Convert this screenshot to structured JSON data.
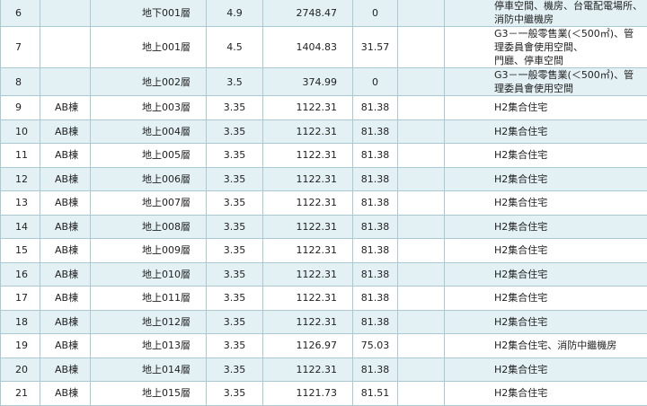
{
  "rows": [
    {
      "no": "6",
      "building": "",
      "floor": "地下001層",
      "height": "4.9",
      "area": "2748.47",
      "balcony": "0",
      "blank": "",
      "use": [
        "停車空間、機房、台電配電場所、消防中繼機房"
      ]
    },
    {
      "no": "7",
      "building": "",
      "floor": "地上001層",
      "height": "4.5",
      "area": "1404.83",
      "balcony": "31.57",
      "blank": "",
      "use": [
        "G3－一般零售業(＜500㎡)、管理委員會使用空間、",
        "門廳、停車空間"
      ]
    },
    {
      "no": "8",
      "building": "",
      "floor": "地上002層",
      "height": "3.5",
      "area": "374.99",
      "balcony": "0",
      "blank": "",
      "use": [
        "G3－一般零售業(＜500㎡)、管理委員會使用空間"
      ]
    },
    {
      "no": "9",
      "building": "AB棟",
      "floor": "地上003層",
      "height": "3.35",
      "area": "1122.31",
      "balcony": "81.38",
      "blank": "",
      "use": [
        "H2集合住宅"
      ]
    },
    {
      "no": "10",
      "building": "AB棟",
      "floor": "地上004層",
      "height": "3.35",
      "area": "1122.31",
      "balcony": "81.38",
      "blank": "",
      "use": [
        "H2集合住宅"
      ]
    },
    {
      "no": "11",
      "building": "AB棟",
      "floor": "地上005層",
      "height": "3.35",
      "area": "1122.31",
      "balcony": "81.38",
      "blank": "",
      "use": [
        "H2集合住宅"
      ]
    },
    {
      "no": "12",
      "building": "AB棟",
      "floor": "地上006層",
      "height": "3.35",
      "area": "1122.31",
      "balcony": "81.38",
      "blank": "",
      "use": [
        "H2集合住宅"
      ]
    },
    {
      "no": "13",
      "building": "AB棟",
      "floor": "地上007層",
      "height": "3.35",
      "area": "1122.31",
      "balcony": "81.38",
      "blank": "",
      "use": [
        "H2集合住宅"
      ]
    },
    {
      "no": "14",
      "building": "AB棟",
      "floor": "地上008層",
      "height": "3.35",
      "area": "1122.31",
      "balcony": "81.38",
      "blank": "",
      "use": [
        "H2集合住宅"
      ]
    },
    {
      "no": "15",
      "building": "AB棟",
      "floor": "地上009層",
      "height": "3.35",
      "area": "1122.31",
      "balcony": "81.38",
      "blank": "",
      "use": [
        "H2集合住宅"
      ]
    },
    {
      "no": "16",
      "building": "AB棟",
      "floor": "地上010層",
      "height": "3.35",
      "area": "1122.31",
      "balcony": "81.38",
      "blank": "",
      "use": [
        "H2集合住宅"
      ]
    },
    {
      "no": "17",
      "building": "AB棟",
      "floor": "地上011層",
      "height": "3.35",
      "area": "1122.31",
      "balcony": "81.38",
      "blank": "",
      "use": [
        "H2集合住宅"
      ]
    },
    {
      "no": "18",
      "building": "AB棟",
      "floor": "地上012層",
      "height": "3.35",
      "area": "1122.31",
      "balcony": "81.38",
      "blank": "",
      "use": [
        "H2集合住宅"
      ]
    },
    {
      "no": "19",
      "building": "AB棟",
      "floor": "地上013層",
      "height": "3.35",
      "area": "1126.97",
      "balcony": "75.03",
      "blank": "",
      "use": [
        "H2集合住宅、消防中繼機房"
      ]
    },
    {
      "no": "20",
      "building": "AB棟",
      "floor": "地上014層",
      "height": "3.35",
      "area": "1122.31",
      "balcony": "81.38",
      "blank": "",
      "use": [
        "H2集合住宅"
      ]
    },
    {
      "no": "21",
      "building": "AB棟",
      "floor": "地上015層",
      "height": "3.35",
      "area": "1121.73",
      "balcony": "81.51",
      "blank": "",
      "use": [
        "H2集合住宅"
      ]
    }
  ],
  "colors": {
    "row_alt": "#e3f1f5",
    "row_plain": "#ffffff",
    "border": "#a9c9d3",
    "text": "#222222"
  }
}
